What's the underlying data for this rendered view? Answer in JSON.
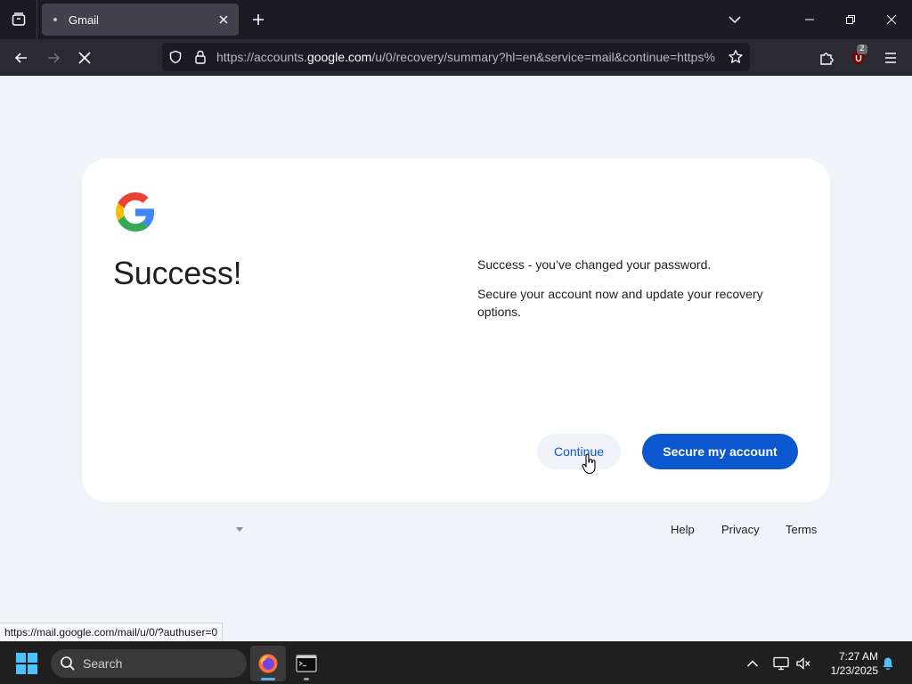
{
  "browser": {
    "tab_title": "Gmail",
    "url_prefix": "https://accounts.",
    "url_host": "google.com",
    "url_rest": "/u/0/recovery/summary?hl=en&service=mail&continue=https%",
    "extension_badge": "2",
    "status_url": "https://mail.google.com/mail/u/0/?authuser=0"
  },
  "page": {
    "heading": "Success!",
    "message_line1": "Success - you’ve changed your password.",
    "message_line2": "Secure your account now and update your recovery options.",
    "continue_label": "Continue",
    "secure_label": "Secure my account",
    "footer": {
      "help": "Help",
      "privacy": "Privacy",
      "terms": "Terms"
    }
  },
  "taskbar": {
    "search_placeholder": "Search",
    "time": "7:27 AM",
    "date": "1/23/2025"
  },
  "colors": {
    "accent": "#0b57d0",
    "page_bg": "#f0f4f9",
    "chrome_bg": "#1c1b22"
  }
}
